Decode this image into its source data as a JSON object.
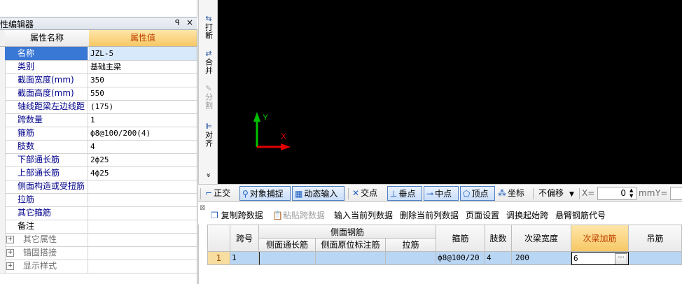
{
  "property_editor": {
    "title": "性编辑器",
    "pin_glyph": "ꟼ",
    "close_glyph": "×",
    "col_name": "属性名称",
    "col_value": "属性值",
    "rows": [
      {
        "name": "名称",
        "value": "JZL-5"
      },
      {
        "name": "类别",
        "value": "基础主梁"
      },
      {
        "name": "截面宽度(mm)",
        "value": "350"
      },
      {
        "name": "截面高度(mm)",
        "value": "550"
      },
      {
        "name": "轴线距梁左边线距",
        "value": "(175)"
      },
      {
        "name": "跨数量",
        "value": "1"
      },
      {
        "name": "箍筋",
        "value": "ф8@100/200(4)"
      },
      {
        "name": "肢数",
        "value": "4"
      },
      {
        "name": "下部通长筋",
        "value": "2ф25"
      },
      {
        "name": "上部通长筋",
        "value": "4ф25"
      },
      {
        "name": "侧面构造或受扭筋",
        "value": ""
      },
      {
        "name": "拉筋",
        "value": ""
      },
      {
        "name": "其它箍筋",
        "value": ""
      },
      {
        "name": "备注",
        "value": ""
      },
      {
        "name": "其它属性",
        "value": ""
      },
      {
        "name": "锚固搭接",
        "value": ""
      },
      {
        "name": "显示样式",
        "value": ""
      }
    ]
  },
  "side_toolbar": {
    "items": [
      {
        "label": "打断",
        "icon": "break-icon"
      },
      {
        "label": "合并",
        "icon": "merge-icon"
      },
      {
        "label": "分割",
        "icon": "split-icon"
      },
      {
        "label": "对齐",
        "icon": "align-icon"
      }
    ],
    "more_glyph": "»"
  },
  "canvas": {
    "axis_y_label": "Y",
    "axis_x_label": "X"
  },
  "snap_toolbar": {
    "orthogonal": "正交",
    "object_snap": "对象捕捉",
    "dynamic_input": "动态输入",
    "intersection": "交点",
    "perpendicular": "垂点",
    "midpoint": "中点",
    "vertex": "顶点",
    "coordinate": "坐标",
    "offset_mode": "不偏移",
    "x_label": "X=",
    "x_value": "0",
    "unit": "mm",
    "y_label": "Y="
  },
  "grid_toolbar": {
    "copy_span": "复制跨数据",
    "paste_span": "粘贴跨数据",
    "input_current_column": "输入当前列数据",
    "delete_current_column": "删除当前列数据",
    "page_setup": "页面设置",
    "swap_start": "调换起始跨",
    "cantilever_code": "悬臂钢筋代号"
  },
  "grid": {
    "headers": {
      "span_no": "跨号",
      "side_rebar": "侧面钢筋",
      "side_through": "侧面通长筋",
      "side_original": "侧面原位标注筋",
      "tie": "拉筋",
      "stirrup": "箍筋",
      "legs": "肢数",
      "secondary_width": "次梁宽度",
      "secondary_add": "次梁加筋",
      "hanger": "吊筋"
    },
    "row": {
      "index": "1",
      "span_no": "1",
      "side_through": "",
      "side_original": "",
      "tie": "",
      "stirrup": "ф8@100/20",
      "legs": "4",
      "secondary_width": "200",
      "secondary_add": "6",
      "hanger": ""
    }
  },
  "colors": {
    "canvas_bg": "#000000",
    "axis_y": "#00c000",
    "axis_x": "#e00000",
    "selected_row": "#b9d6f4",
    "value_header": "#f6c865"
  }
}
